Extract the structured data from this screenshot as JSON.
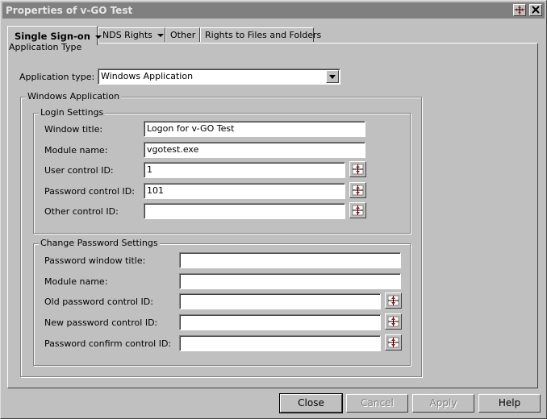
{
  "window": {
    "title": "Properties of v-GO Test"
  },
  "titlebar_icons": {
    "help": "help-cursor-icon",
    "close": "close-icon"
  },
  "tabs": [
    {
      "label": "Single Sign-on",
      "has_dropdown": true,
      "active": true
    },
    {
      "label": "NDS Rights",
      "has_dropdown": true,
      "active": false
    },
    {
      "label": "Other",
      "has_dropdown": false,
      "active": false
    },
    {
      "label": "Rights to Files and Folders",
      "has_dropdown": false,
      "active": false
    }
  ],
  "subtab": {
    "label": "Application Type"
  },
  "app_type": {
    "label": "Application type:",
    "value": "Windows Application"
  },
  "windows_app": {
    "group_label": "Windows Application"
  },
  "login": {
    "group_label": "Login Settings",
    "window_title": {
      "label": "Window title:",
      "value": "Logon for v-GO Test"
    },
    "module_name": {
      "label": "Module name:",
      "value": "vgotest.exe"
    },
    "user_control": {
      "label": "User control ID:",
      "value": "1"
    },
    "password_control": {
      "label": "Password control ID:",
      "value": "101"
    },
    "other_control": {
      "label": "Other control ID:",
      "value": ""
    }
  },
  "change_password": {
    "group_label": "Change Password Settings",
    "window_title": {
      "label": "Password window title:",
      "value": ""
    },
    "module_name": {
      "label": "Module name:",
      "value": ""
    },
    "old_control": {
      "label": "Old password control ID:",
      "value": ""
    },
    "new_control": {
      "label": "New password control ID:",
      "value": ""
    },
    "confirm_control": {
      "label": "Password confirm control ID:",
      "value": ""
    }
  },
  "buttons": {
    "close": "Close",
    "cancel": "Cancel",
    "apply": "Apply",
    "help": "Help"
  },
  "colors": {
    "face": "#c0c0c0",
    "titlebar_inactive": "#808080",
    "field_bg": "#ffffff",
    "disabled_text": "#808080"
  }
}
